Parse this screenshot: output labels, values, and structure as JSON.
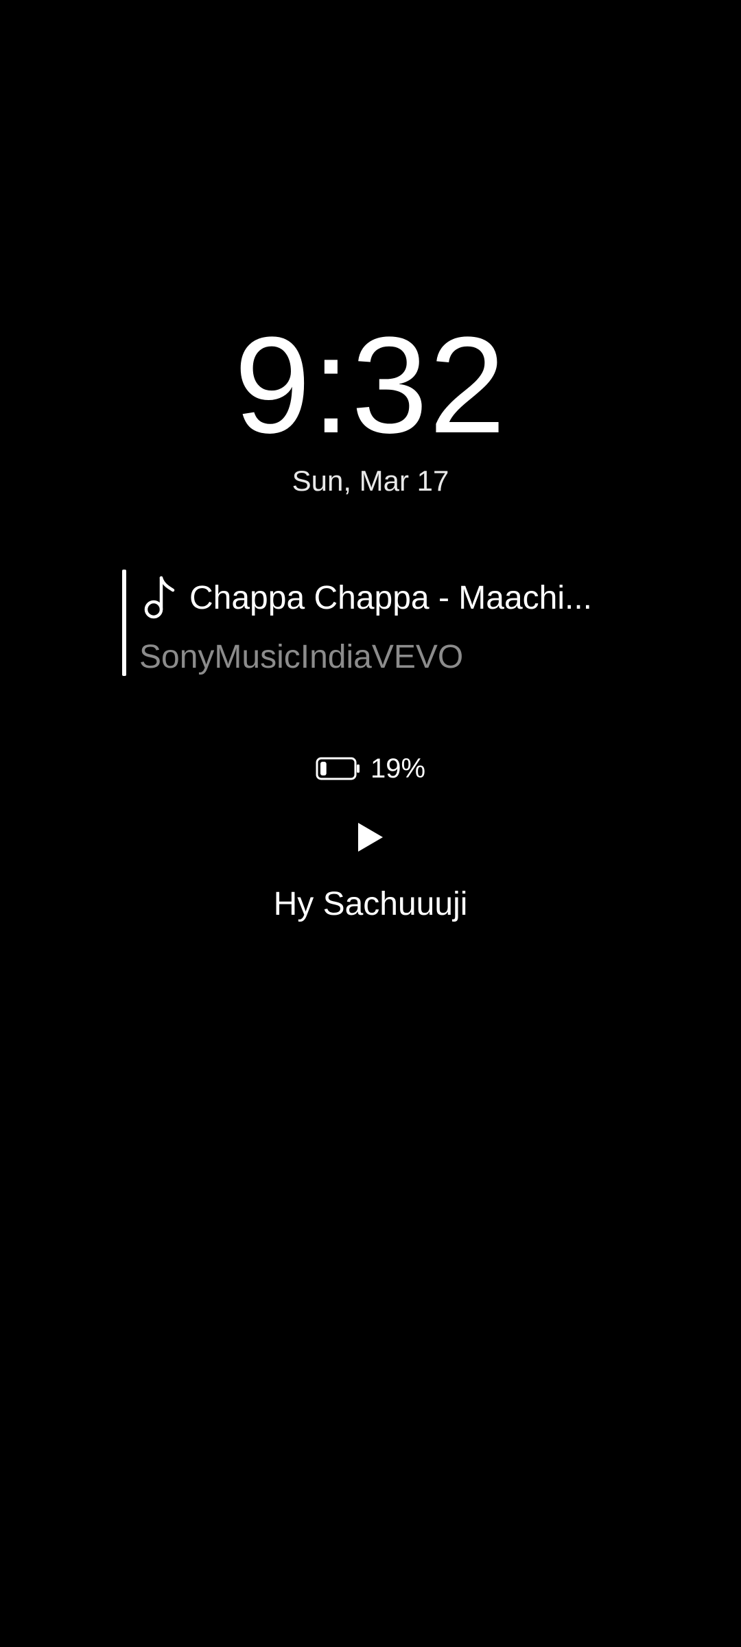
{
  "clock": {
    "time": "9:32",
    "date": "Sun, Mar 17"
  },
  "media": {
    "icon": "music-note-icon",
    "title": "Chappa Chappa - Maachi...",
    "artist": "SonyMusicIndiaVEVO"
  },
  "battery": {
    "icon": "battery-icon",
    "percent": 19,
    "label": "19%"
  },
  "controls": {
    "play_icon": "play-icon"
  },
  "greeting": "Hy Sachuuuji",
  "colors": {
    "background": "#000000",
    "primary_text": "#ffffff",
    "secondary_text": "#8c8c8c"
  }
}
